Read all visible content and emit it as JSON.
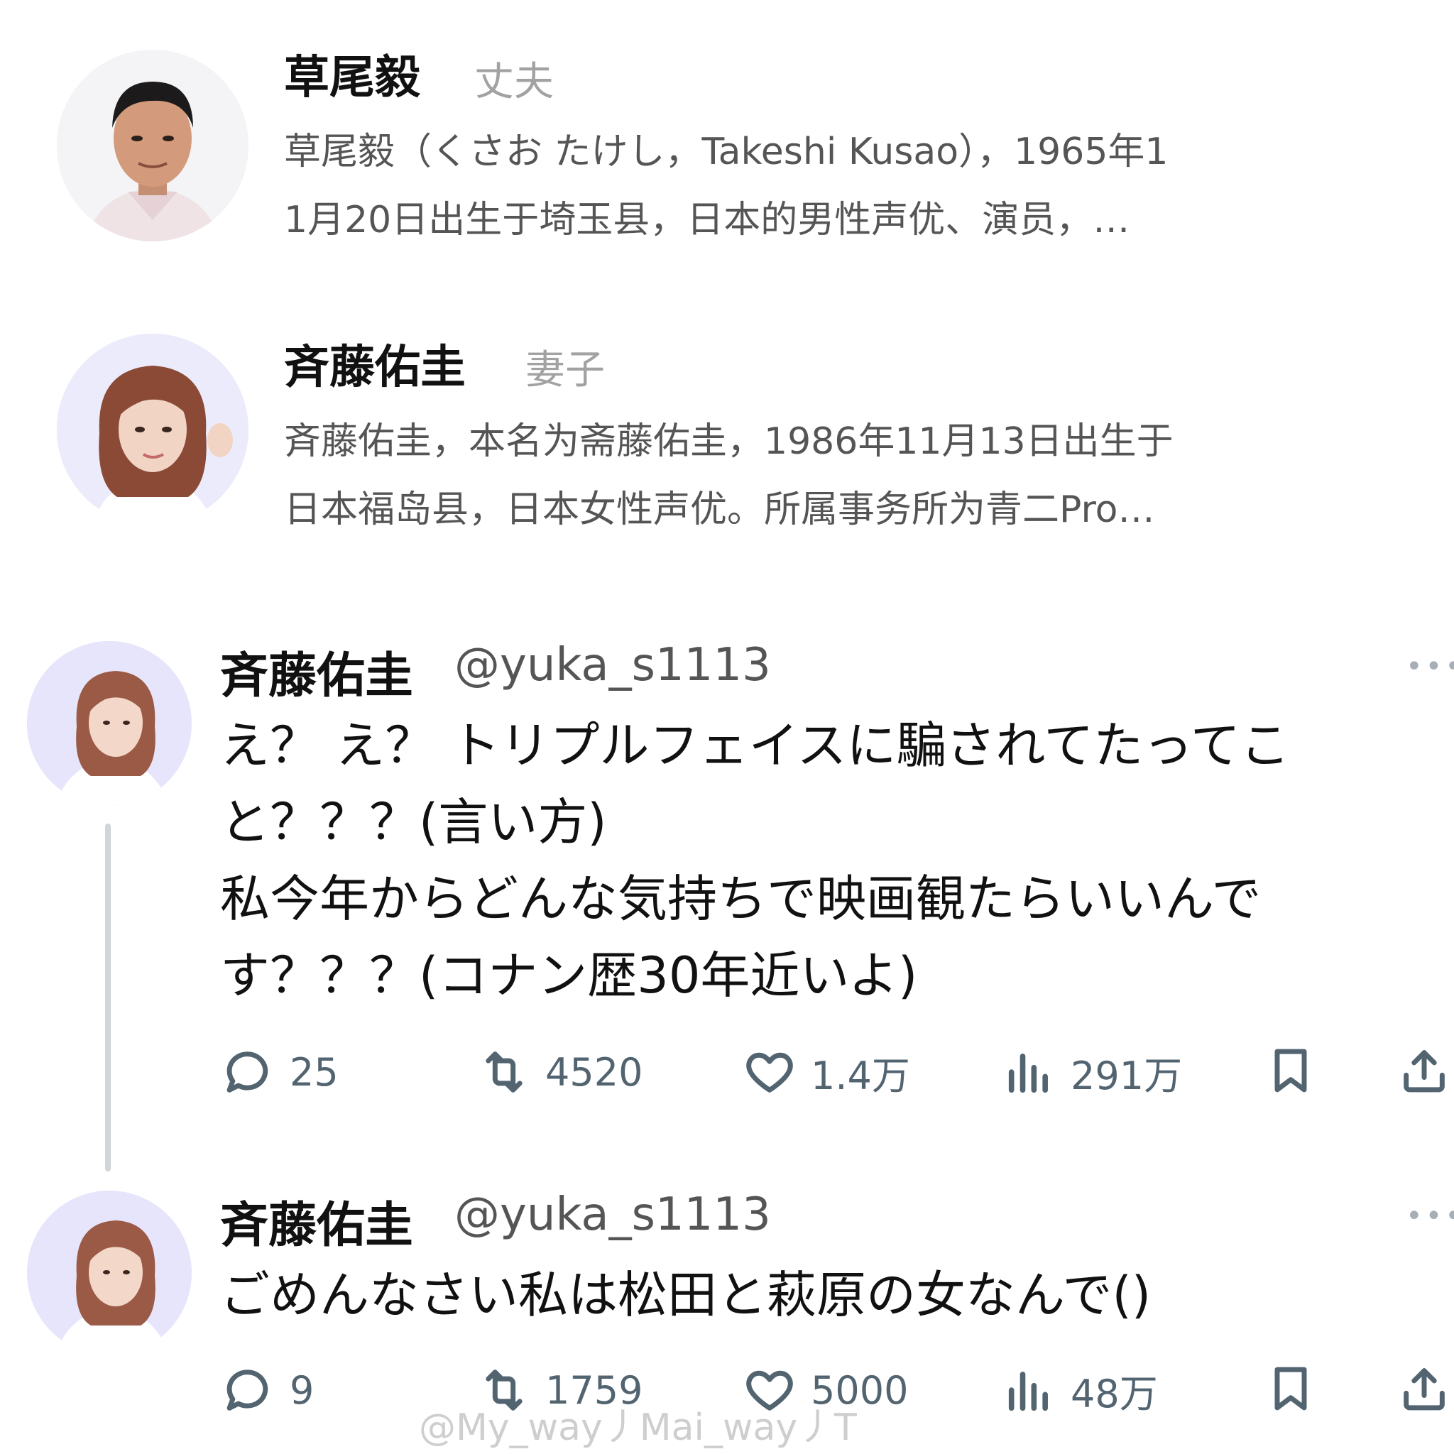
{
  "people": [
    {
      "name": "草尾毅",
      "role": "丈夫",
      "desc_lines": [
        "草尾毅（くさお たけし，Takeshi Kusao），1965年1",
        "1月20日出生于埼玉县，日本的男性声优、演员，…"
      ]
    },
    {
      "name": "斉藤佑圭",
      "role": "妻子",
      "desc_lines": [
        "斉藤佑圭，本名为斋藤佑圭，1986年11月13日出生于",
        "日本福岛县，日本女性声优。所属事务所为青二Pro…"
      ]
    }
  ],
  "tweets": [
    {
      "name": "斉藤佑圭",
      "handle": "@yuka_s1113",
      "more": "•••",
      "lines": [
        "え？ え？ トリプルフェイスに騙されてたってこ",
        "と？？？(言い方)",
        "私今年からどんな気持ちで映画観たらいいんで",
        "す？？？(コナン歴30年近いよ)"
      ],
      "replies": "25",
      "retweets": "4520",
      "likes": "1.4万",
      "views": "291万"
    },
    {
      "name": "斉藤佑圭",
      "handle": "@yuka_s1113",
      "more": "•••",
      "lines": [
        "ごめんなさい私は松田と萩原の女なんで()"
      ],
      "replies": "9",
      "retweets": "1759",
      "likes": "5000",
      "views": "48万"
    }
  ],
  "icons": {
    "reply": "speech-bubble-icon",
    "retweet": "retweet-icon",
    "like": "heart-icon",
    "views": "bar-chart-icon",
    "bookmark": "bookmark-icon",
    "share": "share-upload-icon"
  },
  "colors": {
    "action_gray": "#536471",
    "thread_line": "#cfd5da",
    "avatar_bg": "#e9e7fb"
  },
  "watermark": "@My_way丿Mai_way丿T"
}
